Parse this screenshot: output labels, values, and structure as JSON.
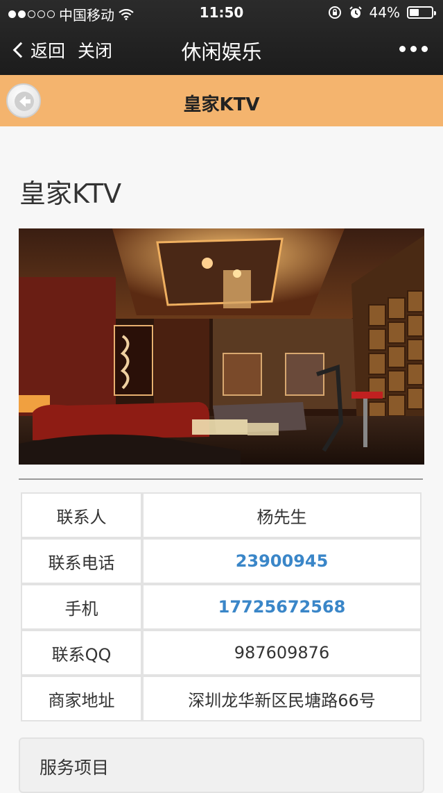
{
  "status_bar": {
    "carrier": "中国移动",
    "time": "11:50",
    "battery": "44%",
    "battery_level": 0.44
  },
  "nav": {
    "back_label": "返回",
    "close_label": "关闭",
    "title": "休闲娱乐"
  },
  "subheader": {
    "title": "皇家KTV"
  },
  "page": {
    "title": "皇家KTV"
  },
  "info_table": {
    "rows": [
      {
        "label": "联系人",
        "value": "杨先生"
      },
      {
        "label": "联系电话",
        "value": "23900945"
      },
      {
        "label": "手机",
        "value": "17725672568"
      },
      {
        "label": "联系QQ",
        "value": "987609876"
      },
      {
        "label": "商家地址",
        "value": "深圳龙华新区民塘路66号"
      }
    ]
  },
  "services": {
    "title": "服务项目"
  },
  "colors": {
    "subheader_bg": "#f4b46e",
    "link": "#3a86c8"
  }
}
